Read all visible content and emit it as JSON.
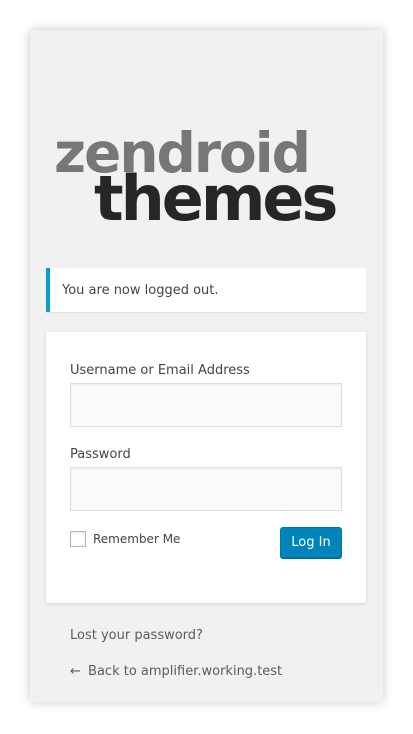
{
  "logo": {
    "line1": "zendroid",
    "line2": "themes"
  },
  "notice": {
    "message": "You are now logged out."
  },
  "form": {
    "username_label": "Username or Email Address",
    "username_value": "",
    "password_label": "Password",
    "password_value": "",
    "remember_label": "Remember Me",
    "remember_checked": false,
    "submit_label": "Log In"
  },
  "links": {
    "lost_password": "Lost your password?",
    "back_arrow": "←",
    "back_to_site": "Back to amplifier.working.test"
  },
  "colors": {
    "accent": "#00a0d2",
    "button": "#0085ba",
    "background": "#f1f1f1",
    "logo_light": "#777777",
    "logo_dark": "#262626"
  }
}
